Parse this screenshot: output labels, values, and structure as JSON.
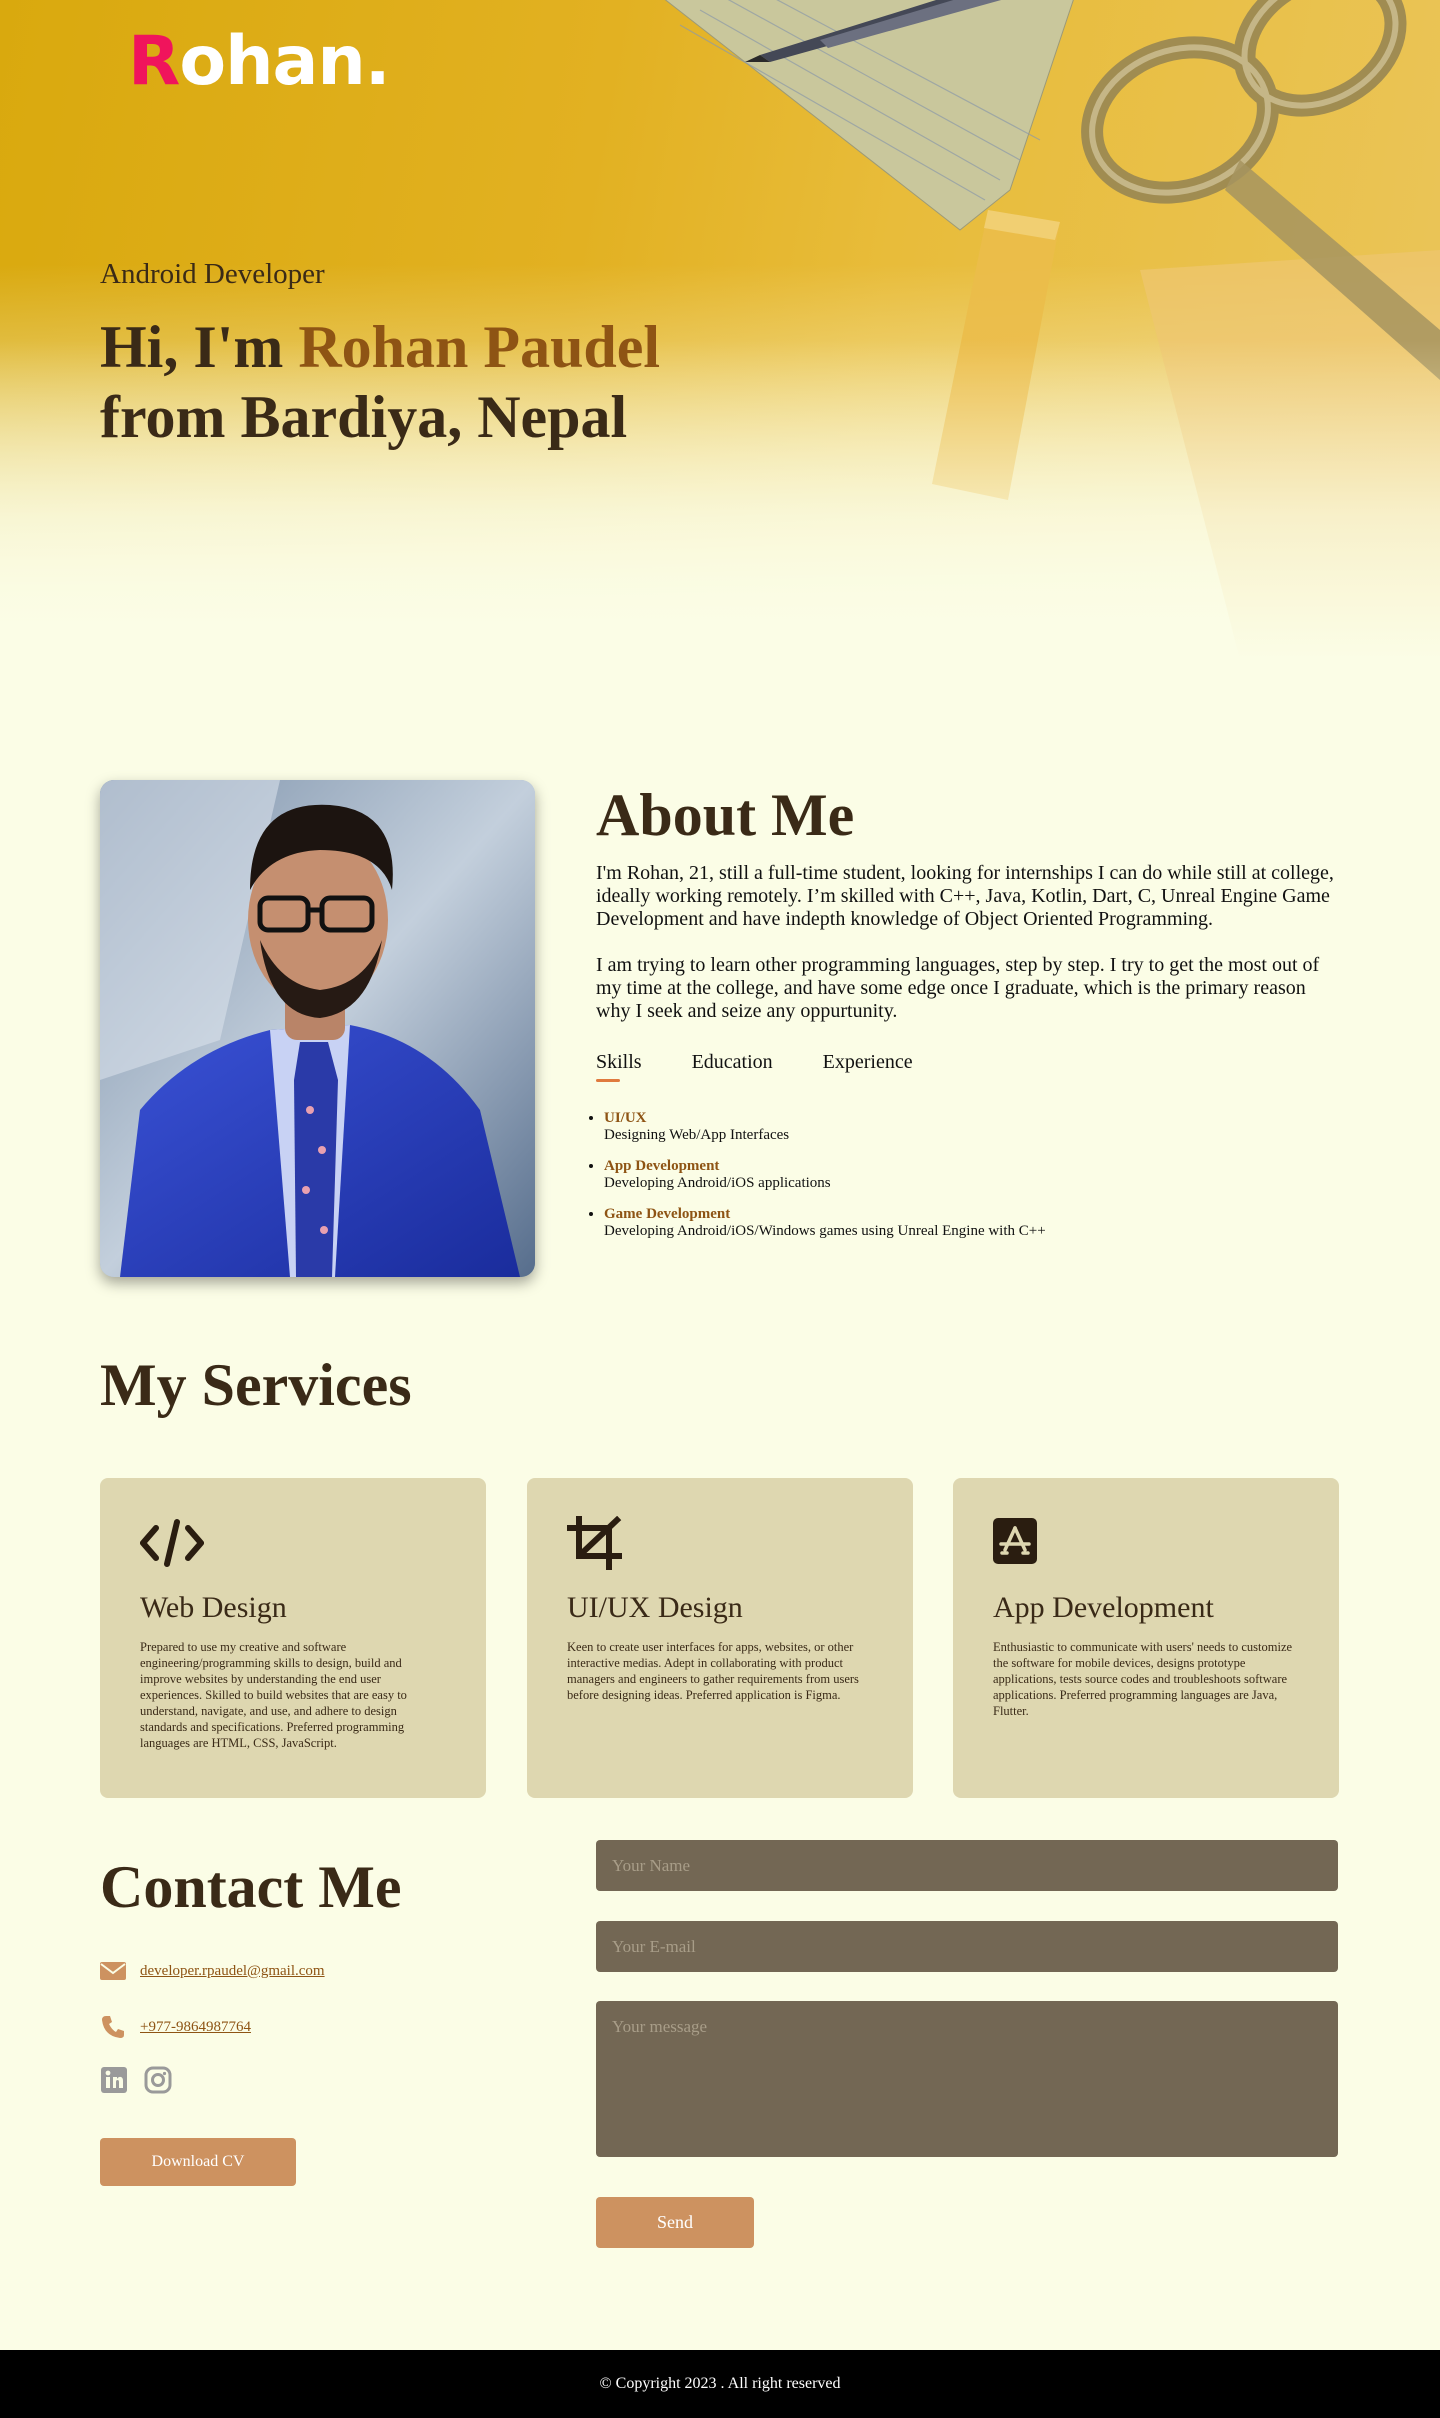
{
  "hero": {
    "logo_first": "R",
    "logo_rest": "ohan.",
    "role": "Android Developer",
    "greeting": "Hi, I'm ",
    "name": "Rohan Paudel",
    "from": "from Bardiya, Nepal"
  },
  "about": {
    "heading": "About Me",
    "paragraph_1": "I'm Rohan, 21, still a full-time student, looking for internships I can do while still at college, ideally working remotely. I’m skilled with C++, Java, Kotlin, Dart, C, Unreal Engine Game Development and have indepth knowledge of Object Oriented Programming.",
    "paragraph_2": "I am trying to learn other programming languages, step by step. I try to get the most out of my time at the college, and have some edge once I graduate, which is the primary reason why I seek and seize any oppurtunity.",
    "tabs": [
      "Skills",
      "Education",
      "Experience"
    ],
    "active_tab": "Skills",
    "skills": [
      {
        "title": "UI/UX",
        "desc": "Designing Web/App Interfaces"
      },
      {
        "title": "App Development",
        "desc": "Developing Android/iOS applications"
      },
      {
        "title": "Game Development",
        "desc": "Developing Android/iOS/Windows games using Unreal Engine with C++"
      }
    ]
  },
  "services": {
    "heading": "My Services",
    "cards": [
      {
        "icon": "code-icon",
        "title": "Web Design",
        "desc": "Prepared to use my creative and software engineering/programming skills to design, build and improve websites by understanding the end user experiences. Skilled to build websites that are easy to understand, navigate, and use, and adhere to design standards and specifications. Preferred programming languages are HTML, CSS, JavaScript."
      },
      {
        "icon": "crop-icon",
        "title": "UI/UX Design",
        "desc": "Keen to create user interfaces for apps, websites, or other interactive medias. Adept in collaborating with product managers and engineers to gather requirements from users before designing ideas. Preferred application is Figma."
      },
      {
        "icon": "app-store-icon",
        "title": "App Development",
        "desc": "Enthusiastic to communicate with users' needs to customize the software for mobile devices, designs prototype applications, tests source codes and troubleshoots software applications. Preferred programming languages are Java, Flutter."
      }
    ]
  },
  "contact": {
    "heading": "Contact Me",
    "email": "developer.rpaudel@gmail.com",
    "phone": "+977-9864987764",
    "download_cv": "Download CV",
    "form": {
      "name_placeholder": "Your Name",
      "email_placeholder": "Your E-mail",
      "message_placeholder": "Your message",
      "send": "Send"
    }
  },
  "footer": {
    "copyright": "© Copyright 2023 . All right reserved"
  },
  "colors": {
    "background": "#fbfde6",
    "accent": "#8e5414",
    "button": "#cd9260",
    "card": "#ded7b0",
    "input": "#736754",
    "logo_accent": "#f0145c"
  }
}
